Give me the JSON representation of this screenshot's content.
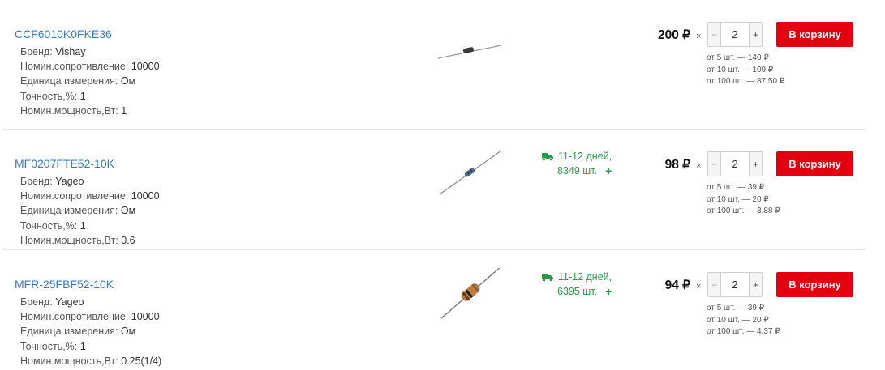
{
  "currency": "₽",
  "times_sign": "×",
  "add_to_cart_label": "В корзину",
  "products": [
    {
      "sku": "CCF6010K0FKE36",
      "params": [
        {
          "label": "Бренд:",
          "value": "Vishay"
        },
        {
          "label": "Номин.сопротивление:",
          "value": "10000"
        },
        {
          "label": "Единица измерения:",
          "value": "Ом"
        },
        {
          "label": "Точность,%:",
          "value": "1"
        },
        {
          "label": "Номин.мощность,Вт:",
          "value": "1"
        }
      ],
      "image_icon": "resistor-small-image",
      "price": "200 ₽",
      "quantity": "2",
      "tiers": [
        "от 5 шт. — 140 ₽",
        "от 10 шт. — 109 ₽",
        "от 100 шт. — 87.50 ₽"
      ]
    },
    {
      "sku": "MF0207FTE52-10K",
      "params": [
        {
          "label": "Бренд:",
          "value": "Yageo"
        },
        {
          "label": "Номин.сопротивление:",
          "value": "10000"
        },
        {
          "label": "Единица измерения:",
          "value": "Ом"
        },
        {
          "label": "Точность,%:",
          "value": "1"
        },
        {
          "label": "Номин.мощность,Вт:",
          "value": "0.6"
        }
      ],
      "image_icon": "resistor-blue-image",
      "stock": {
        "delivery": "11-12 дней,",
        "count": "8349 шт.",
        "plus": "+"
      },
      "price": "98 ₽",
      "quantity": "2",
      "tiers": [
        "от 5 шт. — 39 ₽",
        "от 10 шт. — 20 ₽",
        "от 100 шт. — 3.88 ₽"
      ]
    },
    {
      "sku": "MFR-25FBF52-10K",
      "params": [
        {
          "label": "Бренд:",
          "value": "Yageo"
        },
        {
          "label": "Номин.сопротивление:",
          "value": "10000"
        },
        {
          "label": "Единица измерения:",
          "value": "Ом"
        },
        {
          "label": "Точность,%:",
          "value": "1"
        },
        {
          "label": "Номин.мощность,Вт:",
          "value": "0.25(1/4)"
        }
      ],
      "image_icon": "resistor-brown-image",
      "stock": {
        "delivery": "11-12 дней,",
        "count": "6395 шт.",
        "plus": "+"
      },
      "price": "94 ₽",
      "quantity": "2",
      "tiers": [
        "от 5 шт. — 39 ₽",
        "от 10 шт. — 20 ₽",
        "от 100 шт. — 4.37 ₽"
      ]
    }
  ],
  "colors": {
    "link": "#3a7bbf",
    "stock_green": "#2a9a4a",
    "cart_red": "#e3000f"
  }
}
